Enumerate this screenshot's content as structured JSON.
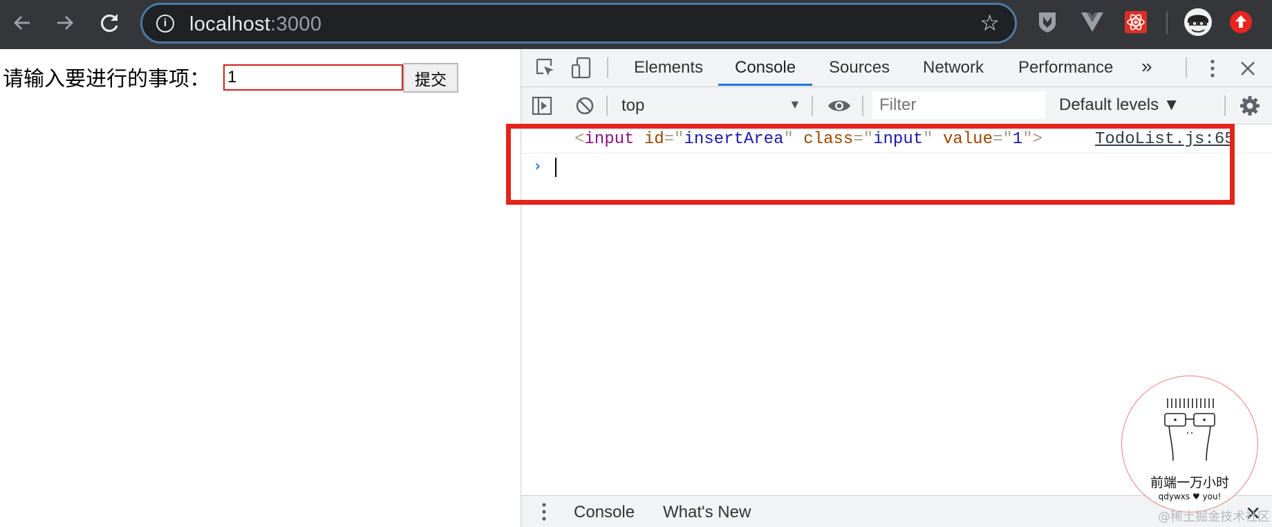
{
  "browser": {
    "url_host": "localhost",
    "url_port": ":3000",
    "icons": {
      "back": "arrow-left-icon",
      "forward": "arrow-right-icon",
      "reload": "reload-icon",
      "site_info": "info-icon",
      "bookmark": "star-icon"
    },
    "extensions": [
      "shield-extension-icon",
      "vue-devtools-icon",
      "react-devtools-icon",
      "profile-avatar",
      "update-icon"
    ]
  },
  "page": {
    "label": "请输入要进行的事项：",
    "input_value": "1",
    "submit_label": "提交"
  },
  "devtools": {
    "tabs": [
      {
        "label": "Elements"
      },
      {
        "label": "Console",
        "active": true
      },
      {
        "label": "Sources"
      },
      {
        "label": "Network"
      },
      {
        "label": "Performance"
      }
    ],
    "more_tabs": "»",
    "toolbar": {
      "context": "top",
      "filter_placeholder": "Filter",
      "levels": "Default levels ▼"
    },
    "console": {
      "log": {
        "open_bracket": "<",
        "tag": "input",
        "attr1_name": "id",
        "attr1_value": "insertArea",
        "attr2_name": "class",
        "attr2_value": "input",
        "attr3_name": "value",
        "attr3_value": "1",
        "close_bracket": ">",
        "equals": "=",
        "quote": "\"",
        "source": "TodoList.js:65"
      },
      "prompt": "›"
    },
    "drawer": {
      "tabs": [
        "Console",
        "What's New"
      ],
      "close": "✕"
    }
  },
  "overlay": {
    "stamp_title": "前端一万小时",
    "stamp_sub": "qdywxs ♥ you!",
    "watermark": "@稀土掘金技术社区"
  },
  "colors": {
    "browser_bar": "#35363a",
    "highlight": "#e3241b",
    "active_tab": "#1a73e8"
  }
}
